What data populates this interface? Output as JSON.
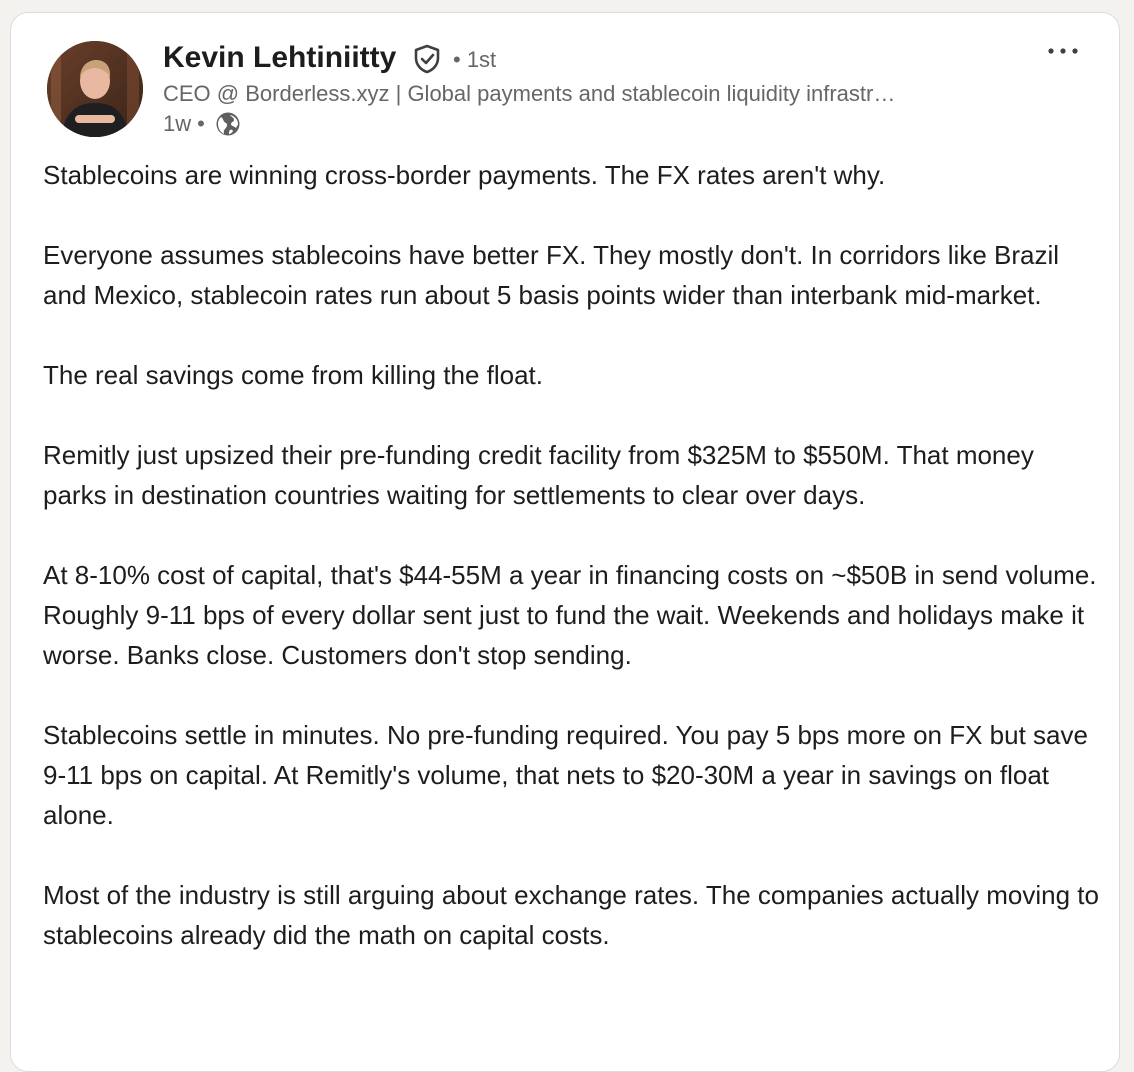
{
  "post": {
    "author": {
      "name": "Kevin Lehtiniitty",
      "verified_icon": "verified-shield-icon",
      "degree": "• 1st",
      "headline": "CEO @ Borderless.xyz | Global payments and stablecoin liquidity infrastr…",
      "time": "1w",
      "visibility_icon": "globe-icon"
    },
    "paragraphs": [
      "Stablecoins are winning cross-border payments. The FX rates aren't why.",
      "Everyone assumes stablecoins have better FX. They mostly don't. In corridors like Brazil and Mexico, stablecoin rates run about 5 basis points wider than interbank mid-market.",
      "The real savings come from killing the float.",
      "Remitly just upsized their pre-funding credit facility from $325M to $550M. That money parks in destination countries waiting for settlements to clear over days.",
      "At 8-10% cost of capital, that's $44-55M a year in financing costs on ~$50B in send volume. Roughly 9-11 bps of every dollar sent just to fund the wait. Weekends and holidays make it worse. Banks close. Customers don't stop sending.",
      "Stablecoins settle in minutes. No pre-funding required. You pay 5 bps more on FX but save 9-11 bps on capital. At Remitly's volume, that nets to $20-30M a year in savings on float alone.",
      "Most of the industry is still arguing about exchange rates. The companies actually moving to stablecoins already did the math on capital costs."
    ]
  },
  "colors": {
    "text_primary": "#1d1d1d",
    "text_secondary": "#666666",
    "card_background": "#ffffff",
    "page_background": "#f4f2ee"
  }
}
